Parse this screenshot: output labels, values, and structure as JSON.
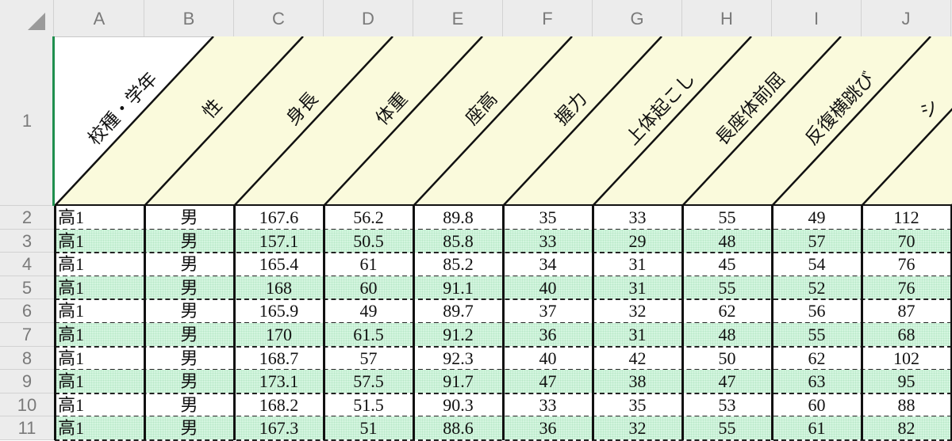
{
  "columns": [
    "A",
    "B",
    "C",
    "D",
    "E",
    "F",
    "G",
    "H",
    "I",
    "J"
  ],
  "row_numbers": [
    "1",
    "2",
    "3",
    "4",
    "5",
    "6",
    "7",
    "8",
    "9",
    "10",
    "11"
  ],
  "headers": [
    "校種・学年",
    "性",
    "身長",
    "体重",
    "座高",
    "握力",
    "上体起こし",
    "長座体前屈",
    "反復横跳び",
    "シ"
  ],
  "rows": [
    [
      "高1",
      "男",
      "167.6",
      "56.2",
      "89.8",
      "35",
      "33",
      "55",
      "49",
      "112"
    ],
    [
      "高1",
      "男",
      "157.1",
      "50.5",
      "85.8",
      "33",
      "29",
      "48",
      "57",
      "70"
    ],
    [
      "高1",
      "男",
      "165.4",
      "61",
      "85.2",
      "34",
      "31",
      "45",
      "54",
      "76"
    ],
    [
      "高1",
      "男",
      "168",
      "60",
      "91.1",
      "40",
      "31",
      "55",
      "52",
      "76"
    ],
    [
      "高1",
      "男",
      "165.9",
      "49",
      "89.7",
      "37",
      "32",
      "62",
      "56",
      "87"
    ],
    [
      "高1",
      "男",
      "170",
      "61.5",
      "91.2",
      "36",
      "31",
      "48",
      "55",
      "68"
    ],
    [
      "高1",
      "男",
      "168.7",
      "57",
      "92.3",
      "40",
      "42",
      "50",
      "62",
      "102"
    ],
    [
      "高1",
      "男",
      "173.1",
      "57.5",
      "91.7",
      "47",
      "38",
      "47",
      "63",
      "95"
    ],
    [
      "高1",
      "男",
      "168.2",
      "51.5",
      "90.3",
      "33",
      "35",
      "53",
      "60",
      "88"
    ],
    [
      "高1",
      "男",
      "167.3",
      "51",
      "88.6",
      "36",
      "32",
      "55",
      "61",
      "82"
    ]
  ],
  "colors": {
    "header_fill": "#fafadc",
    "row_shade": "#d4f5df",
    "selection": "#1f8f4e",
    "chrome": "#ececec"
  }
}
